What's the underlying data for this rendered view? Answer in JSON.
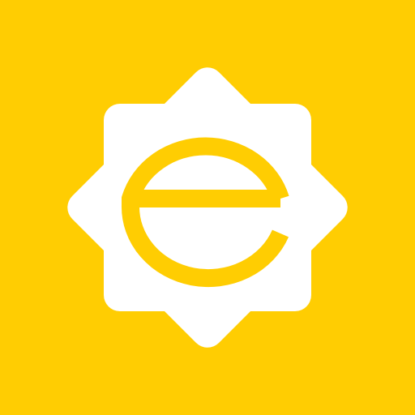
{
  "icon": {
    "name": "e-sun-logo",
    "background_color": "#FFCD02",
    "badge_color": "#FFFFFF",
    "glyph_color": "#FFCD02"
  }
}
